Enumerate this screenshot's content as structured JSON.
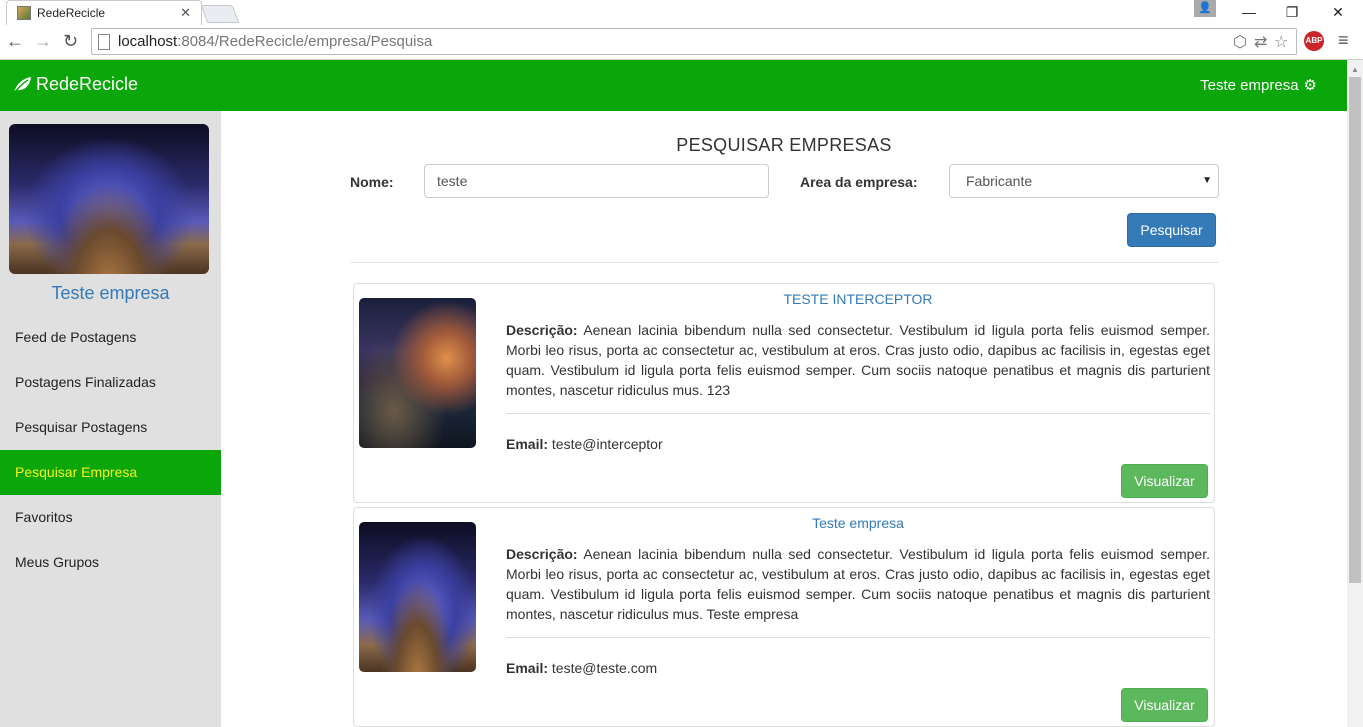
{
  "browser": {
    "tab_title": "RedeRecicle",
    "url_host": "localhost",
    "url_path": ":8084/RedeRecicle/empresa/Pesquisa",
    "abp_label": "ABP"
  },
  "navbar": {
    "brand": "RedeRecicle",
    "user_label": "Teste empresa"
  },
  "sidebar": {
    "profile_name": "Teste empresa",
    "items": [
      {
        "label": "Feed de Postagens"
      },
      {
        "label": "Postagens Finalizadas"
      },
      {
        "label": "Pesquisar Postagens"
      },
      {
        "label": "Pesquisar Empresa"
      },
      {
        "label": "Favoritos"
      },
      {
        "label": "Meus Grupos"
      }
    ]
  },
  "search": {
    "title": "PESQUISAR EMPRESAS",
    "name_label": "Nome:",
    "name_value": "teste",
    "area_label": "Area da empresa:",
    "area_value": "Fabricante",
    "submit_label": "Pesquisar"
  },
  "results": [
    {
      "title": "TESTE INTERCEPTOR",
      "desc_label": "Descrição:",
      "desc": "Aenean lacinia bibendum nulla sed consectetur. Vestibulum id ligula porta felis euismod semper. Morbi leo risus, porta ac consectetur ac, vestibulum at eros. Cras justo odio, dapibus ac facilisis in, egestas eget quam. Vestibulum id ligula porta felis euismod semper. Cum sociis natoque penatibus et magnis dis parturient montes, nascetur ridiculus mus. 123",
      "email_label": "Email:",
      "email": "teste@interceptor",
      "button": "Visualizar"
    },
    {
      "title": "Teste empresa",
      "desc_label": "Descrição:",
      "desc": "Aenean lacinia bibendum nulla sed consectetur. Vestibulum id ligula porta felis euismod semper. Morbi leo risus, porta ac consectetur ac, vestibulum at eros. Cras justo odio, dapibus ac facilisis in, egestas eget quam. Vestibulum id ligula porta felis euismod semper. Cum sociis natoque penatibus et magnis dis parturient montes, nascetur ridiculus mus. Teste empresa",
      "email_label": "Email:",
      "email": "teste@teste.com",
      "button": "Visualizar"
    }
  ],
  "colors": {
    "brand_green": "#0aa60a",
    "active_text": "#f3f31c",
    "link_blue": "#337ab7",
    "primary_button": "#337ab7",
    "success_button": "#5cb85c"
  }
}
